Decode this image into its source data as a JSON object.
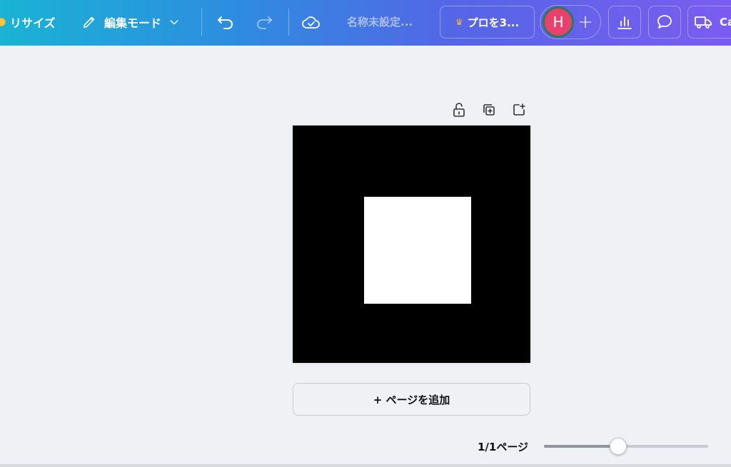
{
  "topbar": {
    "resize_label": "リサイズ",
    "edit_mode_label": "編集モード",
    "doc_title": "名称未設定...",
    "pro_label": "プロを3...",
    "avatar_initial": "H",
    "plus_label": "+",
    "share_label": "Ca",
    "icons": [
      "coin-icon",
      "pencil-icon",
      "chevron-down-icon",
      "undo-icon",
      "redo-icon",
      "cloud-check-icon",
      "crown-icon",
      "bar-chart-icon",
      "comment-icon",
      "truck-icon"
    ]
  },
  "canvas": {
    "page_tools": [
      "lock-icon",
      "duplicate-page-icon",
      "add-page-icon"
    ],
    "page_background": "#000000",
    "square_color": "#ffffff",
    "add_page_label": "+ ページを追加"
  },
  "footer": {
    "page_count": "1/1ページ",
    "zoom_level": 0.45
  },
  "colors": {
    "avatar": "#e8416e",
    "crown": "#f7b733"
  }
}
